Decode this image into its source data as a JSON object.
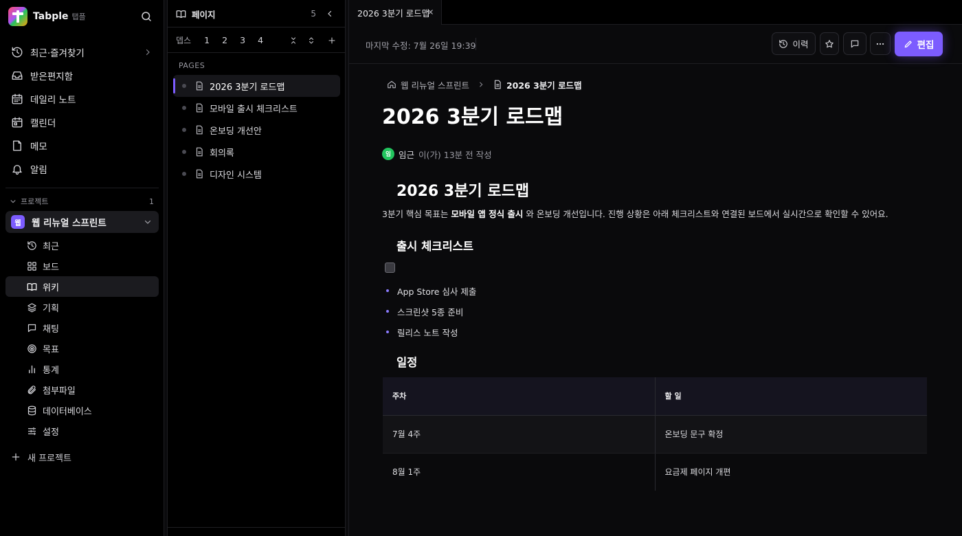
{
  "app": {
    "name": "Tabple",
    "sub": "탭플"
  },
  "nav": [
    {
      "label": "최근·즐겨찾기",
      "icon": "history-icon"
    },
    {
      "label": "받은편지함",
      "icon": "inbox-icon"
    },
    {
      "label": "데일리 노트",
      "icon": "calendar-icon"
    },
    {
      "label": "캘린더",
      "icon": "calendar-check-icon"
    },
    {
      "label": "메모",
      "icon": "note-icon"
    },
    {
      "label": "알림",
      "icon": "bell-icon"
    }
  ],
  "projects": {
    "header": "프로젝트",
    "count": "1",
    "current": {
      "avatar": "웹",
      "name": "웹 리뉴얼 스프린트"
    },
    "sub_items": [
      {
        "label": "최근",
        "icon": "history-icon"
      },
      {
        "label": "보드",
        "icon": "board-icon"
      },
      {
        "label": "위키",
        "icon": "book-icon",
        "active": true
      },
      {
        "label": "기획",
        "icon": "layers-icon"
      },
      {
        "label": "채팅",
        "icon": "chat-icon"
      },
      {
        "label": "목표",
        "icon": "target-icon"
      },
      {
        "label": "통계",
        "icon": "chart-icon"
      },
      {
        "label": "첨부파일",
        "icon": "paperclip-icon"
      },
      {
        "label": "데이터베이스",
        "icon": "database-icon"
      },
      {
        "label": "설정",
        "icon": "sliders-icon"
      }
    ],
    "new_label": "새 프로젝트"
  },
  "pages_panel": {
    "title": "페이지",
    "count": "5",
    "depth_label": "뎁스",
    "depths": [
      "1",
      "2",
      "3",
      "4"
    ],
    "section_label": "PAGES",
    "items": [
      {
        "label": "2026 3분기 로드맵",
        "active": true
      },
      {
        "label": "모바일 출시 체크리스트"
      },
      {
        "label": "온보딩 개선안"
      },
      {
        "label": "회의록"
      },
      {
        "label": "디자인 시스템"
      }
    ]
  },
  "tab": {
    "label": "2026 3분기 로드맵"
  },
  "toolbar": {
    "modified": "마지막 수정: 7월 26일 19:39",
    "history_label": "이력",
    "edit_label": "편집",
    "accent": "#7c5cff"
  },
  "doc": {
    "breadcrumb_project": "웹 리뉴얼 스프린트",
    "breadcrumb_page": "2026 3분기 로드맵",
    "title": "2026 3분기 로드맵",
    "author_avatar": "임",
    "author_name": "임근",
    "author_meta": "이(가) 13분 전 작성",
    "heading": "2026 3분기 로드맵",
    "para_pre": "3분기 핵심 목표는 ",
    "para_bold": "모바일 앱 정식 출시",
    "para_post": " 와 온보딩 개선입니다. 진행 상황은 아래 체크리스트와 연결된 보드에서 실시간으로 확인할 수 있어요.",
    "checklist_heading": "출시 체크리스트",
    "bullets": [
      "App Store 심사 제출",
      "스크린샷 5종 준비",
      "릴리스 노트 작성"
    ],
    "schedule_heading": "일정",
    "table": {
      "headers": [
        "주차",
        "할 일"
      ],
      "rows": [
        [
          "7월 4주",
          "온보딩 문구 확정"
        ],
        [
          "8월 1주",
          "요금제 페이지 개편"
        ]
      ]
    }
  }
}
